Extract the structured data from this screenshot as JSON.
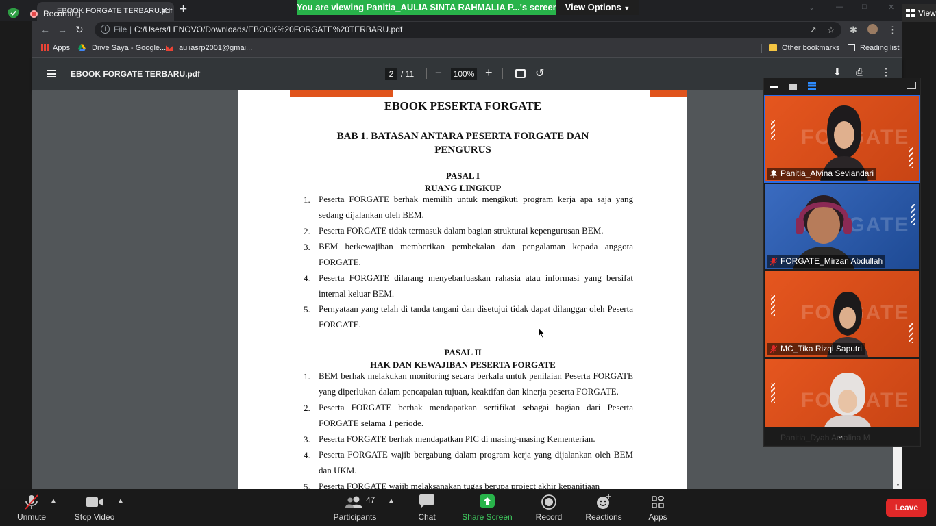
{
  "browser": {
    "tab_title": "EBOOK FORGATE TERBARU.pdf",
    "recording_label": "Recording",
    "new_tab": "+",
    "close_tab": "✕",
    "url_scheme_label": "File",
    "url": "C:/Users/LENOVO/Downloads/EBOOK%20FORGATE%20TERBARU.pdf",
    "bookmarks": [
      {
        "label": "Apps"
      },
      {
        "label": "Drive Saya - Google..."
      },
      {
        "label": "auliasrp2001@gmai..."
      }
    ],
    "other_bookmarks": "Other bookmarks",
    "reading_list": "Reading list"
  },
  "zoom_share": {
    "banner": "You are viewing Panitia_AULIA SINTA RAHMALIA P...'s screen",
    "view_options": "View Options",
    "view_button": "View"
  },
  "pdf_viewer": {
    "title": "EBOOK FORGATE TERBARU.pdf",
    "current_page": "2",
    "total_pages": "/ 11",
    "zoom": "100%"
  },
  "document": {
    "heading": "EBOOK PESERTA FORGATE",
    "chapter_line1": "BAB 1. BATASAN ANTARA PESERTA FORGATE DAN",
    "chapter_line2": "PENGURUS",
    "pasal1_title": "PASAL I",
    "pasal1_subtitle": "RUANG LINGKUP",
    "pasal1_items": [
      {
        "num": "1.",
        "text": "Peserta FORGATE berhak memilih untuk mengikuti program kerja apa saja yang sedang dijalankan oleh BEM."
      },
      {
        "num": "2.",
        "text": "Peserta FORGATE tidak termasuk dalam bagian struktural kepengurusan BEM."
      },
      {
        "num": "3.",
        "text": "BEM berkewajiban memberikan pembekalan dan pengalaman kepada anggota FORGATE."
      },
      {
        "num": "4.",
        "text": "Peserta FORGATE dilarang menyebarluaskan rahasia atau informasi yang bersifat internal keluar BEM."
      },
      {
        "num": "5.",
        "text": "Pernyataan yang telah di tanda tangani dan disetujui tidak dapat dilanggar oleh Peserta FORGATE."
      }
    ],
    "pasal2_title": "PASAL II",
    "pasal2_subtitle": "HAK DAN KEWAJIBAN PESERTA FORGATE",
    "pasal2_items": [
      {
        "num": "1.",
        "text": "BEM berhak melakukan monitoring secara berkala untuk penilaian Peserta FORGATE yang diperlukan dalam pencapaian tujuan, keaktifan dan kinerja peserta FORGATE."
      },
      {
        "num": "2.",
        "text": "Peserta FORGATE berhak mendapatkan sertifikat sebagai bagian dari Peserta FORGATE selama 1 periode."
      },
      {
        "num": "3.",
        "text": "Peserta FORGATE berhak mendapatkan PIC di masing-masing Kementerian."
      },
      {
        "num": "4.",
        "text": "Peserta FORGATE wajib bergabung dalam program kerja yang dijalankan oleh BEM dan UKM."
      },
      {
        "num": "5.",
        "text": "Peserta FORGATE wajib melaksanakan tugas berupa project akhir kepanitiaan"
      }
    ]
  },
  "participants_gallery": [
    {
      "name": "Panitia_Alvina Seviandari",
      "muted": false,
      "bg": "#e0531e"
    },
    {
      "name": "FORGATE_Mirzan Abdullah",
      "muted": true,
      "bg": "#2f5fb0"
    },
    {
      "name": "MC_Tika Rizqi Saputri",
      "muted": true,
      "bg": "#e0531e"
    },
    {
      "name": "Panitia_Dyah Amalina M",
      "muted": true,
      "bg": "#e0531e"
    }
  ],
  "zoom_toolbar": {
    "unmute": "Unmute",
    "stop_video": "Stop Video",
    "participants": "Participants",
    "participant_count": "47",
    "chat": "Chat",
    "share_screen": "Share Screen",
    "record": "Record",
    "reactions": "Reactions",
    "apps": "Apps",
    "leave": "Leave"
  },
  "colors": {
    "share_green": "#28b34a",
    "leave_red": "#e02828",
    "forgate_orange": "#e0531e",
    "forgate_blue": "#2f5fb0"
  }
}
